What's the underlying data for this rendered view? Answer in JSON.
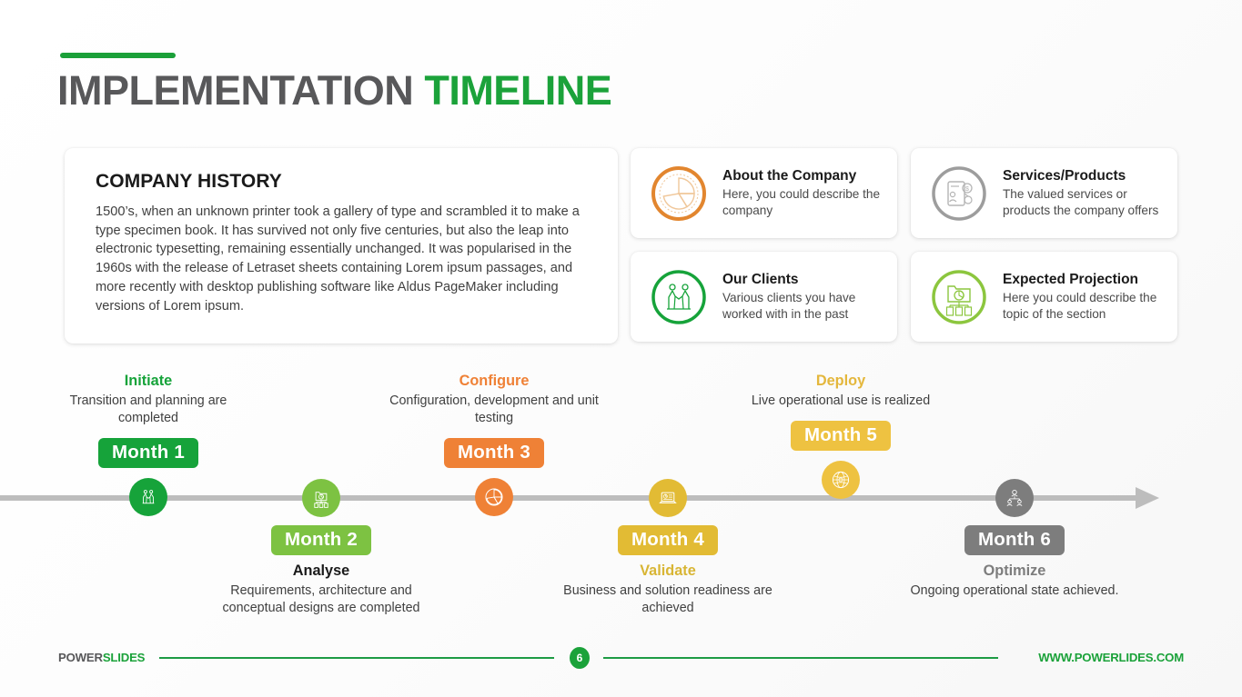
{
  "header": {
    "title_main": "IMPLEMENTATION",
    "title_accent": "TIMELINE"
  },
  "history": {
    "title": "COMPANY HISTORY",
    "body": "1500’s, when an unknown printer took a gallery of type and scrambled it to make a type specimen book. It has survived not only five centuries, but also the leap into electronic typesetting, remaining essentially unchanged. It was popularised in the 1960s with the release of Letraset sheets containing Lorem ipsum passages, and more recently with desktop publishing software like Aldus PageMaker including versions of Lorem ipsum."
  },
  "feature_cards": [
    {
      "title": "About the Company",
      "desc": "Here, you could describe the company",
      "icon": "pie-chart-icon",
      "color": "#e2862f"
    },
    {
      "title": "Services/Products",
      "desc": "The valued services or products the company offers",
      "icon": "mobile-payment-icon",
      "color": "#9d9d9d"
    },
    {
      "title": "Our Clients",
      "desc": "Various clients you have worked with in the past",
      "icon": "handshake-icon",
      "color": "#16a33a"
    },
    {
      "title": "Expected Projection",
      "desc": "Here you could describe the topic of the section",
      "icon": "folder-hierarchy-icon",
      "color": "#8cc63e"
    }
  ],
  "timeline": {
    "axis_color": "#bdbdbd",
    "milestones": [
      {
        "badge": "Month 1",
        "label": "Initiate",
        "desc": "Transition and planning are completed",
        "icon": "handshake-icon",
        "color": "#16a33a",
        "label_color": "#16a33a",
        "position": "up"
      },
      {
        "badge": "Month 2",
        "label": "Analyse",
        "desc": "Requirements, architecture and conceptual designs are completed",
        "icon": "folder-hierarchy-icon",
        "color": "#7dc242",
        "label_color": "#1a1a1a",
        "position": "down"
      },
      {
        "badge": "Month 3",
        "label": "Configure",
        "desc": "Configuration, development and unit testing",
        "icon": "pie-chart-icon",
        "color": "#ef8136",
        "label_color": "#ef8136",
        "position": "up"
      },
      {
        "badge": "Month 4",
        "label": "Validate",
        "desc": "Business and solution readiness are achieved",
        "icon": "laptop-chart-icon",
        "color": "#e2bb34",
        "label_color": "#d8b534",
        "position": "down"
      },
      {
        "badge": "Month 5",
        "label": "Deploy",
        "desc": "Live operational use is realized",
        "icon": "globe-icon",
        "color": "#eec241",
        "label_color": "#e4b73c",
        "position": "up"
      },
      {
        "badge": "Month 6",
        "label": "Optimize",
        "desc": "Ongoing operational state achieved.",
        "icon": "team-icon",
        "color": "#7d7d7d",
        "label_color": "#7d7d7d",
        "position": "down"
      }
    ]
  },
  "footer": {
    "logo_part1": "POWER",
    "logo_part2": "SLIDES",
    "page_number": "6",
    "url": "WWW.POWERLIDES.COM"
  }
}
